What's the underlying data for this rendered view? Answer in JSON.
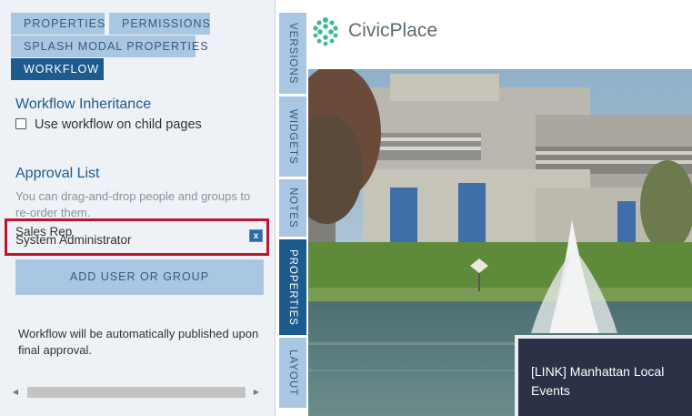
{
  "panel": {
    "tabs": [
      {
        "label": "PROPERTIES",
        "active": false
      },
      {
        "label": "PERMISSIONS",
        "active": false
      },
      {
        "label": "SPLASH MODAL PROPERTIES",
        "active": false
      },
      {
        "label": "WORKFLOW",
        "active": true
      }
    ],
    "workflow_inheritance": {
      "title": "Workflow Inheritance",
      "checkbox_label": "Use workflow on child pages",
      "checked": false
    },
    "approval_list": {
      "title": "Approval List",
      "help": "You can drag-and-drop people and groups to re-order them.",
      "items": [
        "Sales Rep",
        "System Administrator"
      ],
      "remove_label": "x"
    },
    "add_button": "ADD USER OR GROUP",
    "note": "Workflow will be automatically published upon final approval."
  },
  "side_tabs": [
    {
      "label": "VERSIONS",
      "active": false
    },
    {
      "label": "WIDGETS",
      "active": false
    },
    {
      "label": "NOTES",
      "active": false
    },
    {
      "label": "PROPERTIES",
      "active": true
    },
    {
      "label": "LAYOUT",
      "active": false
    }
  ],
  "site": {
    "logo_text": "CivicPlace",
    "event_link": "[LINK] Manhattan Local Events"
  },
  "colors": {
    "accent": "#1d5b8e",
    "tab_inactive": "#a9c7e3",
    "highlight": "#c0142b",
    "event_box": "#2b3146",
    "logo_green": "#3fb89a"
  }
}
